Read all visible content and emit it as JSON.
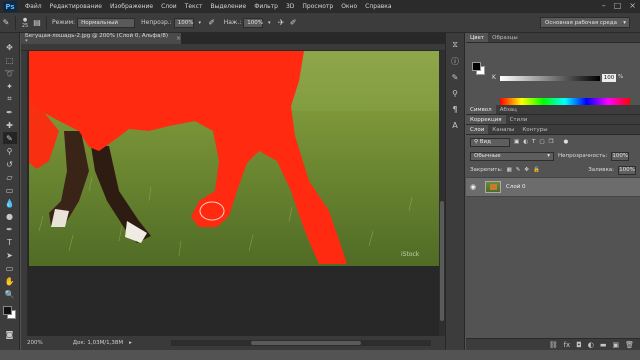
{
  "app": {
    "logo": "Ps"
  },
  "menu": [
    "Файл",
    "Редактирование",
    "Изображение",
    "Слои",
    "Текст",
    "Выделение",
    "Фильтр",
    "3D",
    "Просмотр",
    "Окно",
    "Справка"
  ],
  "options": {
    "brush_size": "25",
    "mode_label": "Режим:",
    "mode_value": "Нормальный",
    "opacity_label": "Непрозр.:",
    "opacity_value": "100%",
    "pressure_label": "Наж.:",
    "pressure_value": "100%",
    "workspace": "Основная рабочая среда"
  },
  "document": {
    "tab_title": "Бегущая-лошадь-2.jpg @ 200% (Слой 0, Альфа/8) *",
    "zoom": "200%",
    "doc_info": "Док: 1,03M/1,38M"
  },
  "panels": {
    "tabs_top": [
      "Цвет",
      "Образцы"
    ],
    "k_label": "K",
    "k_value": "100",
    "k_pct": "%",
    "tabs_mid1": [
      "Символ",
      "Абзац"
    ],
    "tabs_mid2": [
      "Коррекция",
      "Стили"
    ],
    "tabs_layers": [
      "Слои",
      "Каналы",
      "Контуры"
    ],
    "filter_label": "Вид",
    "blend_mode": "Обычные",
    "opacity_label": "Непрозрачность:",
    "opacity_value": "100%",
    "lock_label": "Закрепить:",
    "fill_label": "Заливка:",
    "fill_value": "100%",
    "layer_name": "Слой 0"
  },
  "colors": {
    "mask_red": "#ff2a10",
    "grass": "#6d8c38"
  }
}
